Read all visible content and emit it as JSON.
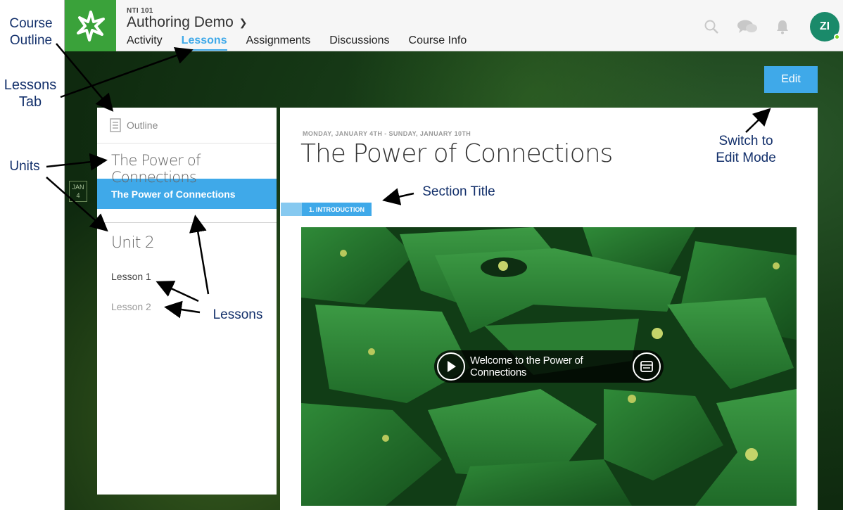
{
  "header": {
    "course_code": "NTI 101",
    "course_title": "Authoring Demo",
    "tabs": [
      {
        "label": "Activity"
      },
      {
        "label": "Lessons"
      },
      {
        "label": "Assignments"
      },
      {
        "label": "Discussions"
      },
      {
        "label": "Course Info"
      }
    ],
    "active_tab": "Lessons",
    "avatar_initials": "ZI",
    "icons": [
      "search-icon",
      "chat-icon",
      "bell-icon"
    ]
  },
  "toolbar": {
    "edit_label": "Edit"
  },
  "date_badge": {
    "month": "JAN",
    "day": "4"
  },
  "sidebar": {
    "outline_label": "Outline",
    "unit1_title": "The Power of Connections",
    "active_lesson": "The Power of Connections",
    "unit2_title": "Unit 2",
    "lessons": [
      {
        "label": "Lesson 1"
      },
      {
        "label": "Lesson 2"
      }
    ]
  },
  "main": {
    "date_range": "MONDAY, JANUARY 4TH - SUNDAY, JANUARY 10TH",
    "title": "The Power of Connections",
    "section_label": "1. INTRODUCTION",
    "video_title": "Welcome to the Power of Connections"
  },
  "annotations": {
    "course_outline": [
      "Course",
      "Outline"
    ],
    "lessons_tab": [
      "Lessons",
      "Tab"
    ],
    "units": "Units",
    "lessons": "Lessons",
    "section_title": "Section Title",
    "edit_mode": [
      "Switch to",
      "Edit Mode"
    ]
  },
  "colors": {
    "accent": "#3fa9e9",
    "logo_green": "#3aa23a",
    "annotation": "#13306b",
    "avatar": "#1a8a6a"
  }
}
